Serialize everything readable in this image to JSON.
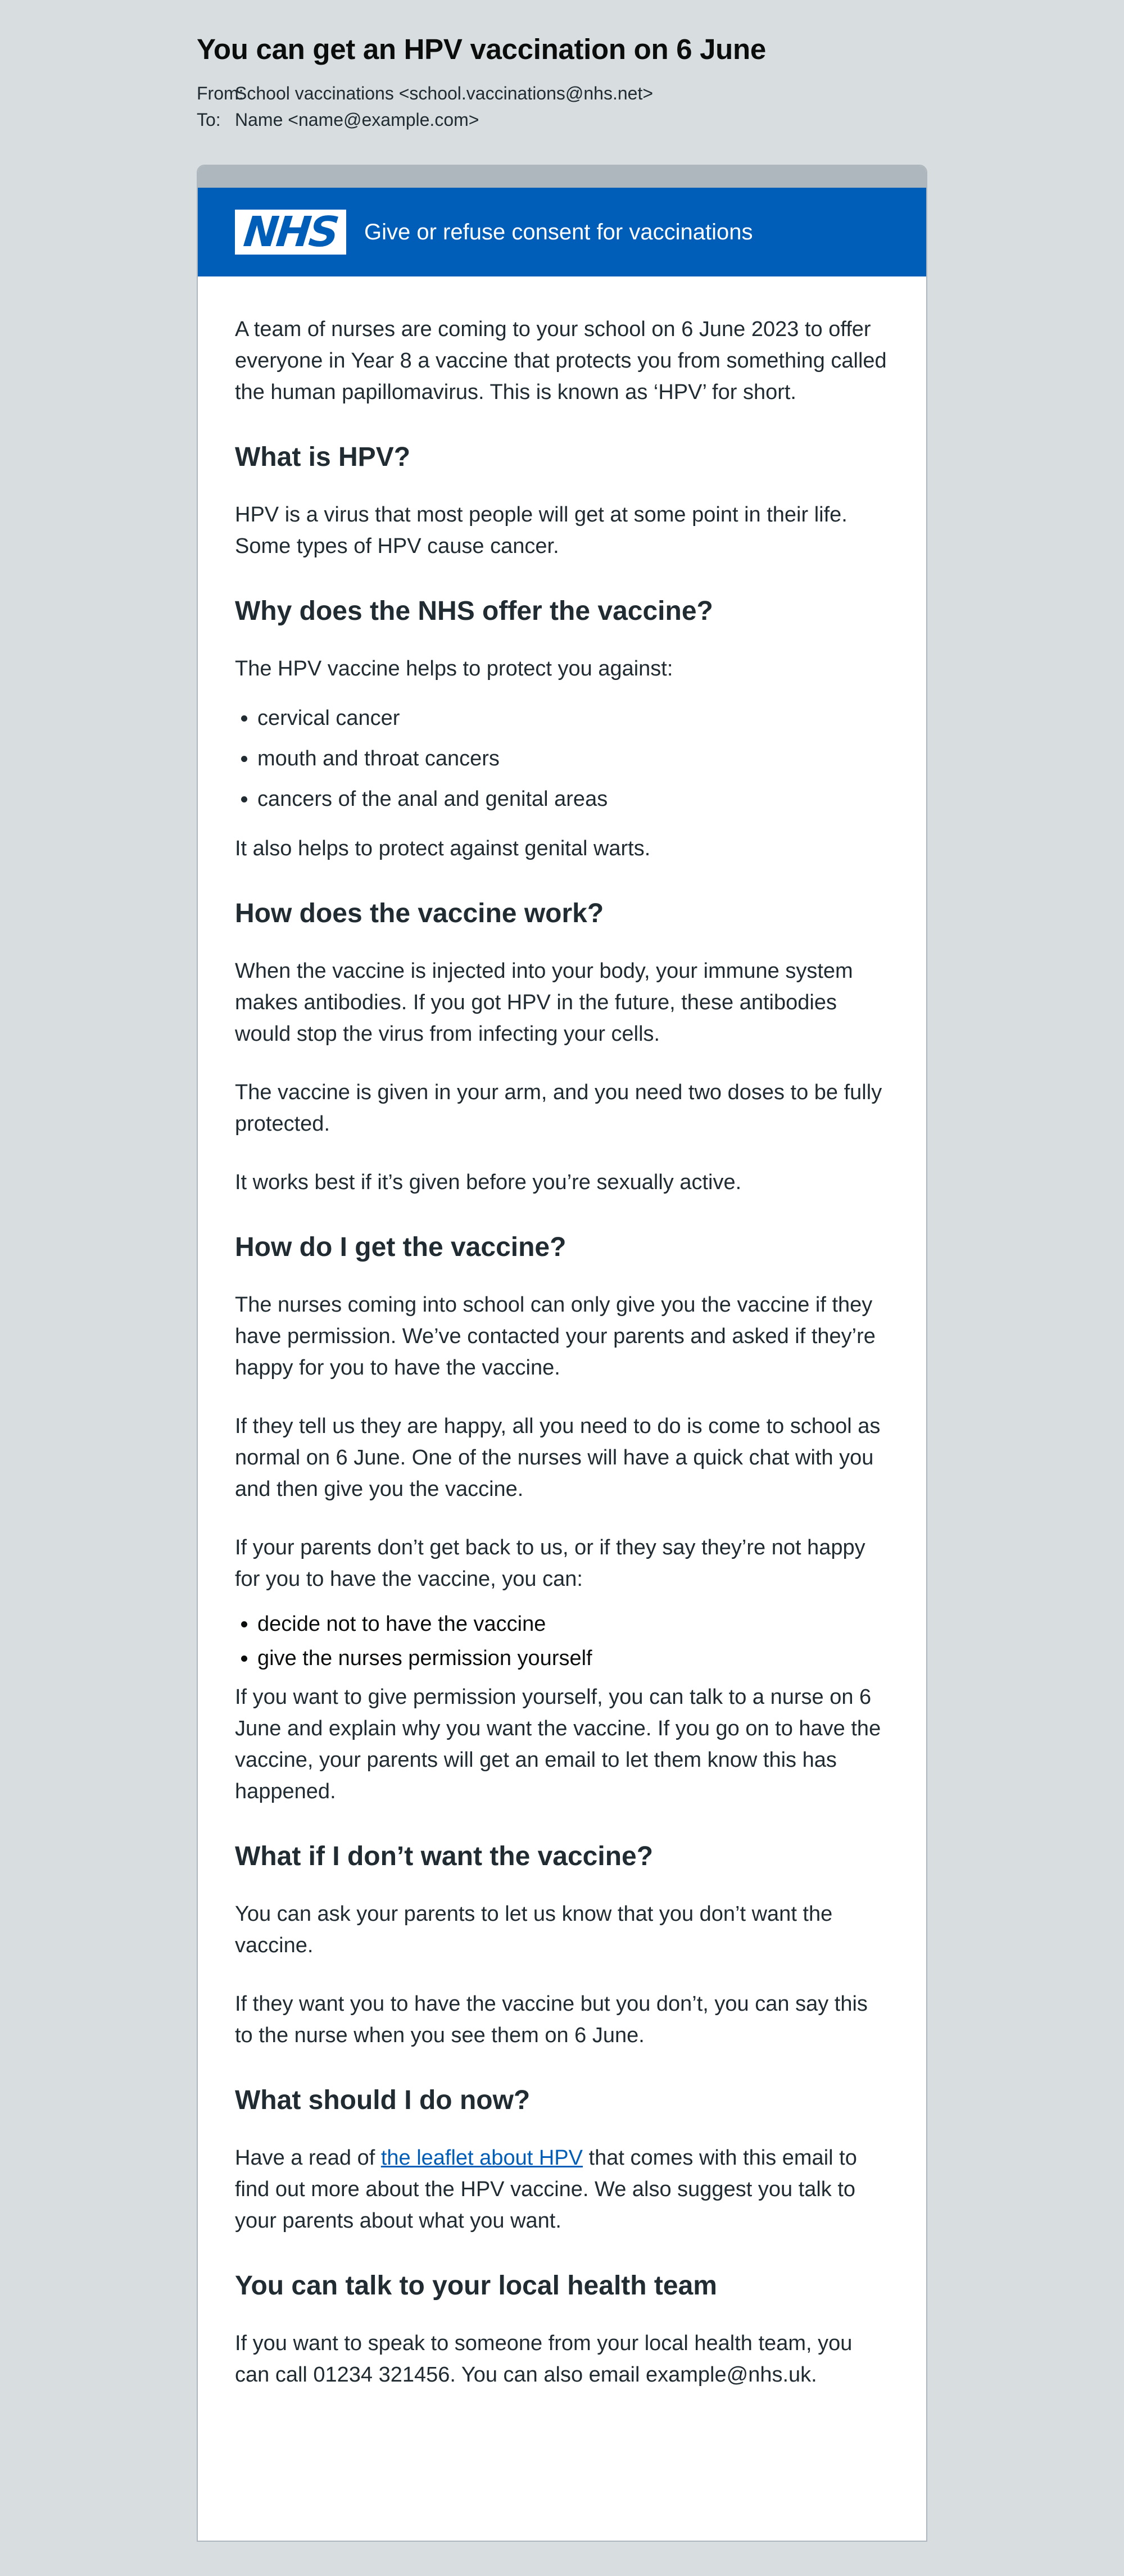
{
  "email": {
    "subject": "You can get an HPV vaccination on 6 June",
    "from_label": "From:",
    "from_value": "School vaccinations <school.vaccinations@nhs.net>",
    "to_label": "To:",
    "to_value": "Name <name@example.com>"
  },
  "banner": {
    "logo_text": "NHS",
    "title": "Give or refuse consent for vaccinations"
  },
  "body": {
    "intro": "A team of nurses are coming to your school on 6 June 2023 to offer everyone in Year 8 a vaccine that protects you from something called the human papillomavirus. This is known as ‘HPV’ for short.",
    "h_what": "What is HPV?",
    "p_what": "HPV is a virus that most people will get at some point in their life. Some types of HPV cause cancer.",
    "h_why": "Why does the NHS offer the vaccine?",
    "p_why": "The HPV vaccine helps to protect you against:",
    "why_list": [
      "cervical cancer",
      "mouth and throat cancers",
      "cancers of the anal and genital areas"
    ],
    "p_warts": "It also helps to protect against genital warts.",
    "h_how": "How does the vaccine work?",
    "p_how1": "When the vaccine is injected into your body, your immune system makes antibodies. If you got HPV in the future, these antibodies would stop the virus from infecting your cells.",
    "p_how2": "The vaccine is given in your arm, and you need two doses to be fully protected.",
    "p_how3": "It works best if it’s given before you’re sexually active.",
    "h_get": "How do I get the vaccine?",
    "p_get1": "The nurses coming into school can only give you the vaccine if they have permission. We’ve contacted your parents and asked if they’re happy for you to have the vaccine.",
    "p_get2": "If they tell us they are happy, all you need to do is come to school as normal on 6 June. One of the nurses will have a quick chat with you and then give you the vaccine.",
    "p_get3": "If your parents don’t get back to us, or if they say they’re not happy for you to have the vaccine, you can:",
    "get_list": [
      "decide not to have the vaccine",
      "give the nurses permission yourself"
    ],
    "p_get4": "If you want to give permission yourself, you can talk to a nurse on 6 June and explain why you want the vaccine. If you go on to have the vaccine, your parents will get an email to let them know this has happened.",
    "h_dont": "What if I don’t want the vaccine?",
    "p_dont1": "You can ask your parents to let us know that you don’t want the vaccine.",
    "p_dont2": "If they want you to have the vaccine but you don’t, you can say this to the nurse when you see them on 6 June.",
    "h_now": "What should I do now?",
    "p_now_before": "Have a read of ",
    "p_now_link": "the leaflet about HPV",
    "p_now_after": " that comes with this email to find out more about the HPV vaccine. We also suggest you talk to your parents about what you want.",
    "h_team": "You can talk to your local health team",
    "p_team": "If you want to speak to someone from your local health team, you can call 01234 321456. You can also email example@nhs.uk."
  }
}
